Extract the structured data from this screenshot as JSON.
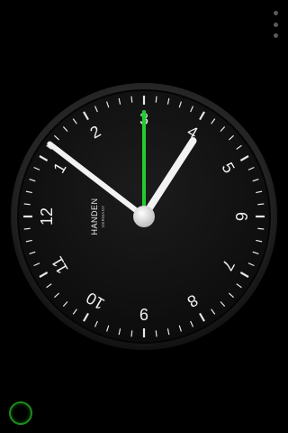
{
  "clock": {
    "brand": "HANDEN",
    "subbrand": "GERMANY",
    "numerals": [
      "12",
      "1",
      "2",
      "3",
      "4",
      "5",
      "6",
      "7",
      "8",
      "9",
      "10",
      "11"
    ],
    "time": {
      "hour": 4,
      "minute": 6,
      "second": 15
    },
    "colors": {
      "face": "#141414",
      "bezel": "#2a2a2a",
      "ticks": "#e6e6e6",
      "numerals": "#f0f0f0",
      "hands": "#f2f2f2",
      "second_hand": "#22cc33"
    }
  },
  "menu": {
    "icon": "overflow-menu-icon"
  },
  "status": {
    "icon": "green-ring-icon",
    "color": "#1e8a1e"
  }
}
